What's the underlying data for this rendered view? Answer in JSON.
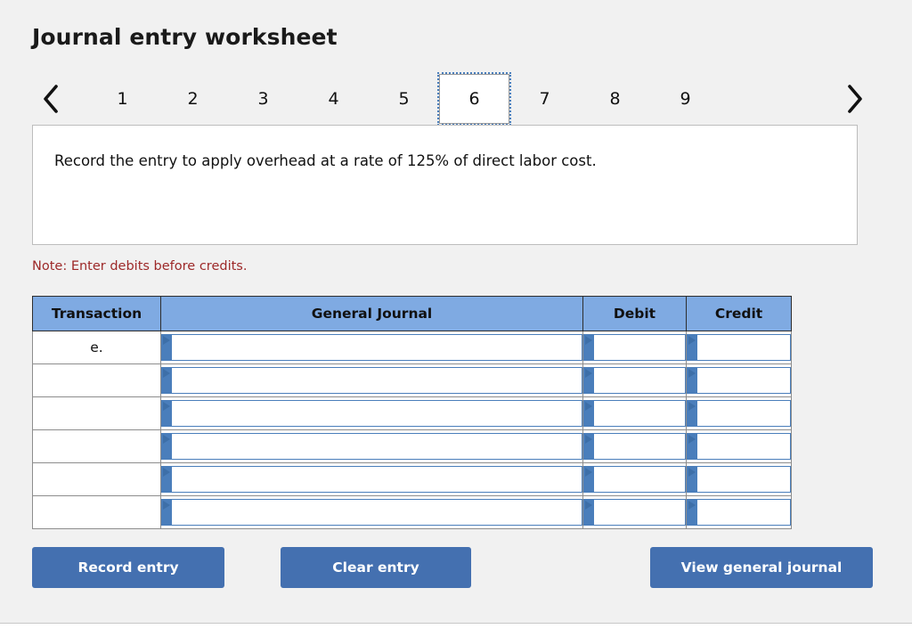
{
  "header": {
    "title": "Journal entry worksheet"
  },
  "pager": {
    "prev_icon": "chevron-left-icon",
    "next_icon": "chevron-right-icon",
    "tabs": [
      "1",
      "2",
      "3",
      "4",
      "5",
      "6",
      "7",
      "8",
      "9"
    ],
    "active_tab": "6"
  },
  "instruction": {
    "text": "Record the entry to apply overhead at a rate of 125% of direct labor cost."
  },
  "note": {
    "text": "Note: Enter debits before credits."
  },
  "table": {
    "columns": [
      "Transaction",
      "General Journal",
      "Debit",
      "Credit"
    ],
    "rows": [
      {
        "transaction": "e.",
        "journal": "",
        "debit": "",
        "credit": ""
      },
      {
        "transaction": "",
        "journal": "",
        "debit": "",
        "credit": ""
      },
      {
        "transaction": "",
        "journal": "",
        "debit": "",
        "credit": ""
      },
      {
        "transaction": "",
        "journal": "",
        "debit": "",
        "credit": ""
      },
      {
        "transaction": "",
        "journal": "",
        "debit": "",
        "credit": ""
      },
      {
        "transaction": "",
        "journal": "",
        "debit": "",
        "credit": ""
      }
    ]
  },
  "buttons": {
    "record": "Record entry",
    "clear": "Clear entry",
    "view": "View general journal"
  },
  "colors": {
    "header_blue": "#7faae2",
    "button_blue": "#4470b0",
    "note_red": "#9d2929",
    "page_background": "#f1f1f1",
    "focus_outline": "#4a7ebb"
  }
}
